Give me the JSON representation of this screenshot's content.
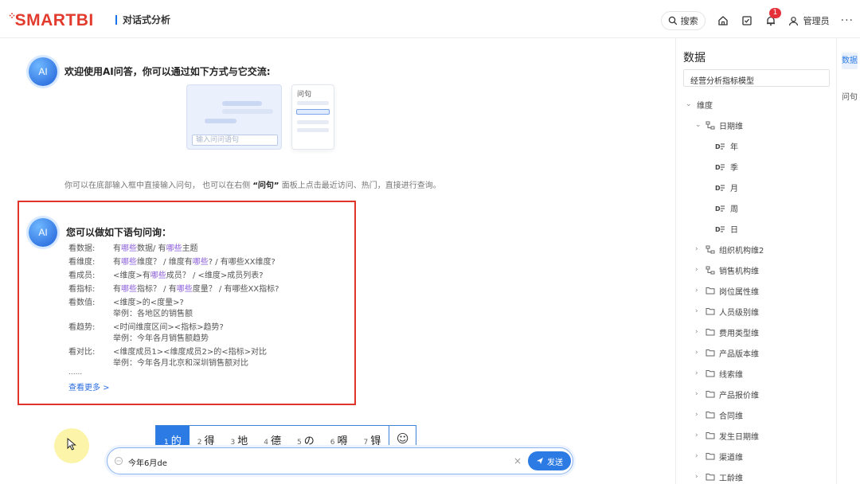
{
  "header": {
    "logo": "SMARTBI",
    "module": "对话式分析",
    "search_label": "搜索",
    "notif_count": "1",
    "user_label": "管理员",
    "more_label": "···"
  },
  "chat": {
    "avatar_label": "AI",
    "welcome": "欢迎使用AI问答，你可以通过如下方式与它交流:",
    "illus_input": "输入问问语句",
    "illus_side_title": "问句",
    "hint_pre": "你可以在底部输入框中直接输入问句， 也可以在右侧 ",
    "hint_bold": "“问句”",
    "hint_post": " 面板上点击最近访问、热门，直接进行查询。",
    "box_title": "您可以做如下语句问询：",
    "rows": [
      {
        "k": "看数据:",
        "v1": "有",
        "h1": "哪些",
        "v2": "数据/ 有",
        "h2": "哪些",
        "v3": "主题",
        "ex": ""
      },
      {
        "k": "看维度:",
        "v1": "有",
        "h1": "哪些",
        "v2": "维度？ / 维度有",
        "h2": "哪些",
        "v3": "? / 有哪些XX维度?",
        "ex": ""
      },
      {
        "k": "看成员:",
        "v1": "<维度>有",
        "h1": "哪些",
        "v2": "成员？ / <维度>成员列表?",
        "h2": "",
        "v3": "",
        "ex": ""
      },
      {
        "k": "看指标:",
        "v1": "有",
        "h1": "哪些",
        "v2": "指标？ / 有",
        "h2": "哪些",
        "v3": "度量？ / 有哪些XX指标?",
        "ex": ""
      },
      {
        "k": "看数值:",
        "v1": "<维度>的<度量>?",
        "h1": "",
        "v2": "",
        "h2": "",
        "v3": "",
        "ex": "举例：各地区的销售额"
      },
      {
        "k": "看趋势:",
        "v1": "<时间维度区间><指标>趋势?",
        "h1": "",
        "v2": "",
        "h2": "",
        "v3": "",
        "ex": "举例：今年各月销售额趋势"
      },
      {
        "k": "看对比:",
        "v1": "<维度成员1><维度成员2>的<指标>对比",
        "h1": "",
        "v2": "",
        "h2": "",
        "v3": "",
        "ex": "举例：今年各月北京和深圳销售额对比"
      }
    ],
    "ellipsis": "......",
    "see_more": "查看更多 >"
  },
  "ime": {
    "candidates": [
      {
        "n": "1",
        "t": "的"
      },
      {
        "n": "2",
        "t": "得"
      },
      {
        "n": "3",
        "t": "地"
      },
      {
        "n": "4",
        "t": "德"
      },
      {
        "n": "5",
        "t": "の"
      },
      {
        "n": "6",
        "t": "嘚"
      },
      {
        "n": "7",
        "t": "锝"
      }
    ],
    "emoji": "☺"
  },
  "input": {
    "value": "今年6月de",
    "clear": "×",
    "send_label": "发送"
  },
  "panel": {
    "title": "数据",
    "model": "经营分析指标模型",
    "tree": [
      {
        "label": "维度",
        "level": 0,
        "chev": "⌄",
        "icon": "none"
      },
      {
        "label": "日期维",
        "level": 1,
        "chev": "⌄",
        "icon": "hier"
      },
      {
        "label": "年",
        "level": 2,
        "chev": "",
        "icon": "date"
      },
      {
        "label": "季",
        "level": 2,
        "chev": "",
        "icon": "date"
      },
      {
        "label": "月",
        "level": 2,
        "chev": "",
        "icon": "date"
      },
      {
        "label": "周",
        "level": 2,
        "chev": "",
        "icon": "date"
      },
      {
        "label": "日",
        "level": 2,
        "chev": "",
        "icon": "date"
      },
      {
        "label": "组织机构维2",
        "level": 1,
        "chev": "›",
        "icon": "hier"
      },
      {
        "label": "销售机构维",
        "level": 1,
        "chev": "›",
        "icon": "hier"
      },
      {
        "label": "岗位属性维",
        "level": 1,
        "chev": "›",
        "icon": "folder"
      },
      {
        "label": "人员级别维",
        "level": 1,
        "chev": "›",
        "icon": "folder"
      },
      {
        "label": "费用类型维",
        "level": 1,
        "chev": "›",
        "icon": "folder"
      },
      {
        "label": "产品版本维",
        "level": 1,
        "chev": "›",
        "icon": "folder"
      },
      {
        "label": "线索维",
        "level": 1,
        "chev": "›",
        "icon": "folder"
      },
      {
        "label": "产品报价维",
        "level": 1,
        "chev": "›",
        "icon": "folder"
      },
      {
        "label": "合同维",
        "level": 1,
        "chev": "›",
        "icon": "folder"
      },
      {
        "label": "发生日期维",
        "level": 1,
        "chev": "›",
        "icon": "folder"
      },
      {
        "label": "渠道维",
        "level": 1,
        "chev": "›",
        "icon": "folder"
      },
      {
        "label": "工龄维",
        "level": 1,
        "chev": "›",
        "icon": "folder"
      }
    ]
  },
  "tabs": [
    {
      "label": "数据"
    },
    {
      "label": "问句"
    }
  ],
  "colors": {
    "brand": "#e23b2e",
    "accent": "#2c7be5",
    "highlight": "#8b5cd9",
    "alert": "#e0352b"
  }
}
